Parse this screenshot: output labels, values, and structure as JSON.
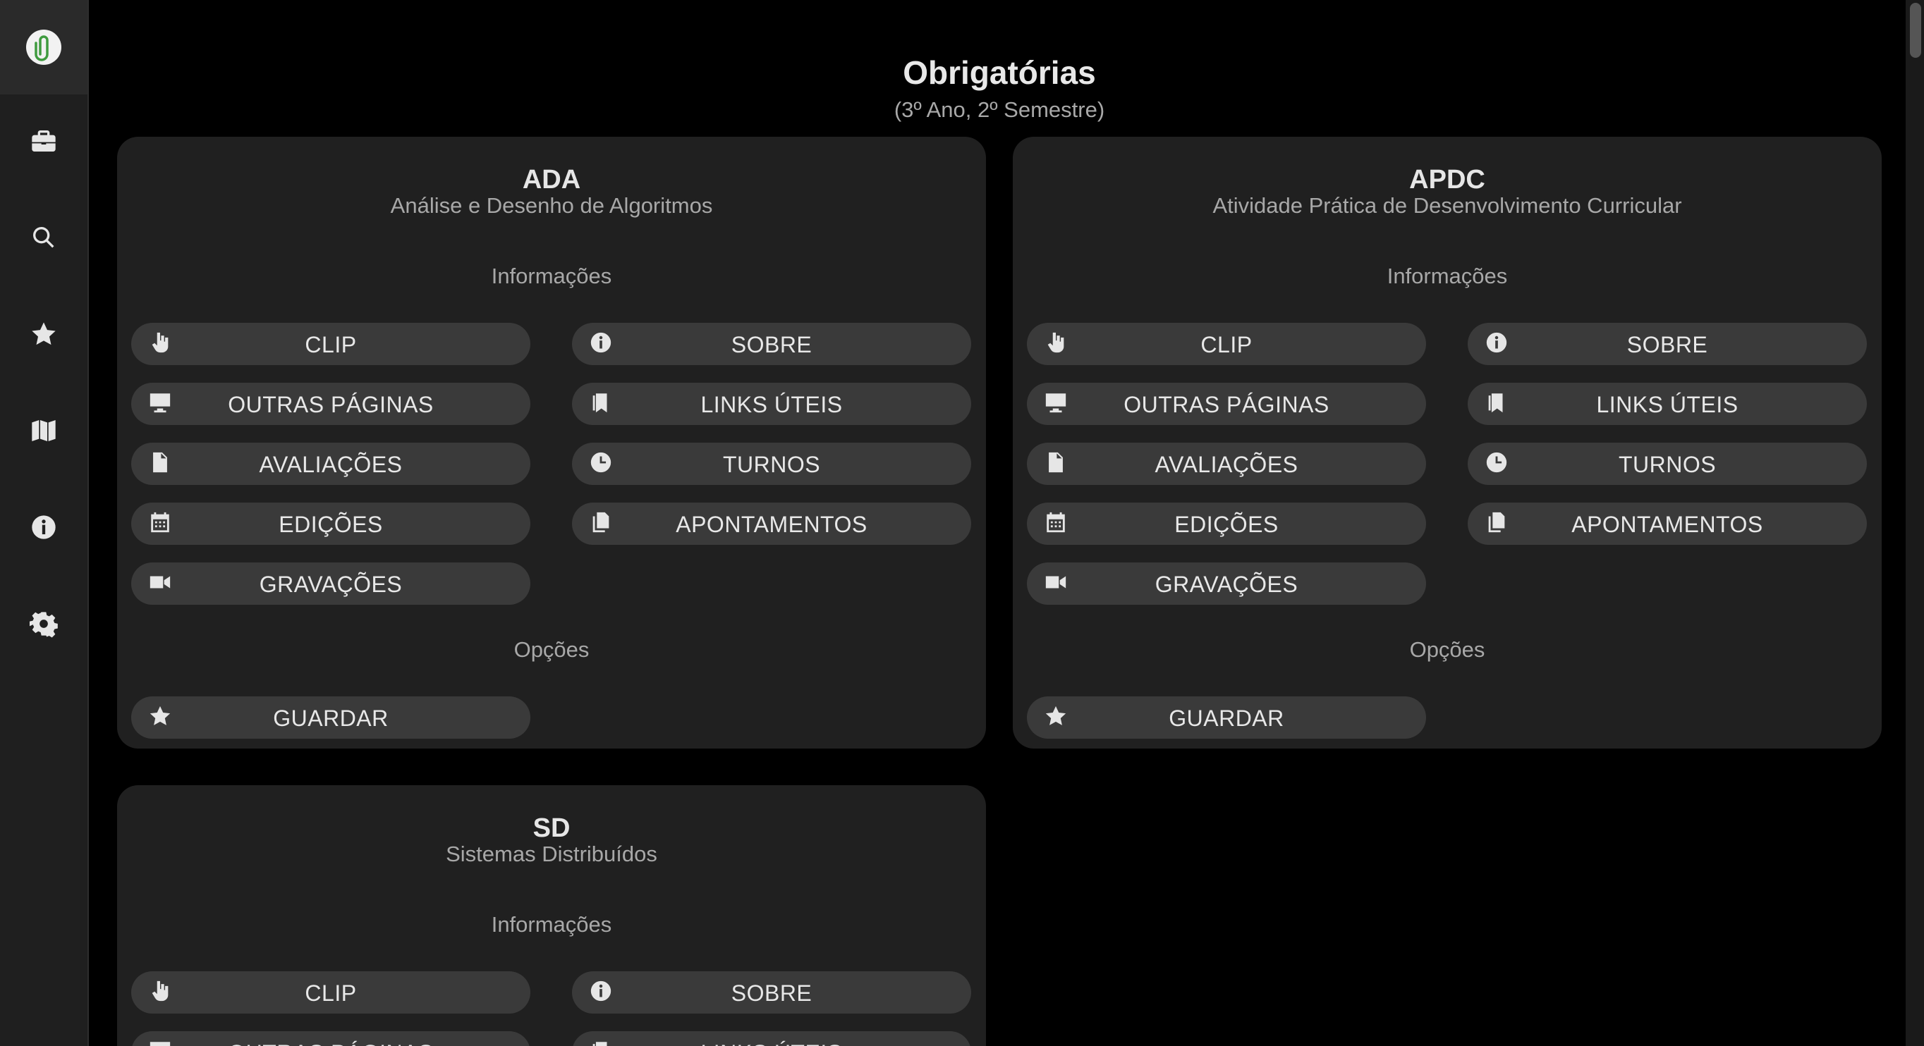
{
  "page": {
    "title": "Obrigatórias",
    "subtitle": "(3º Ano, 2º Semestre)"
  },
  "sidebar": {
    "items": [
      {
        "icon": "briefcase-icon"
      },
      {
        "icon": "search-icon"
      },
      {
        "icon": "star-icon"
      },
      {
        "icon": "map-icon"
      },
      {
        "icon": "info-icon"
      },
      {
        "icon": "gear-icon"
      }
    ]
  },
  "labels": {
    "info_section": "Informações",
    "options_section": "Opções",
    "clip": "CLIP",
    "sobre": "SOBRE",
    "outras": "OUTRAS PÁGINAS",
    "links": "LINKS ÚTEIS",
    "avaliacoes": "AVALIAÇÕES",
    "turnos": "TURNOS",
    "edicoes": "EDIÇÕES",
    "apontamentos": "APONTAMENTOS",
    "gravacoes": "GRAVAÇÕES",
    "guardar": "GUARDAR"
  },
  "courses": [
    {
      "code": "ADA",
      "name": "Análise e Desenho de Algoritmos"
    },
    {
      "code": "APDC",
      "name": "Atividade Prática de Desenvolvimento Curricular"
    },
    {
      "code": "SD",
      "name": "Sistemas Distribuídos"
    }
  ]
}
